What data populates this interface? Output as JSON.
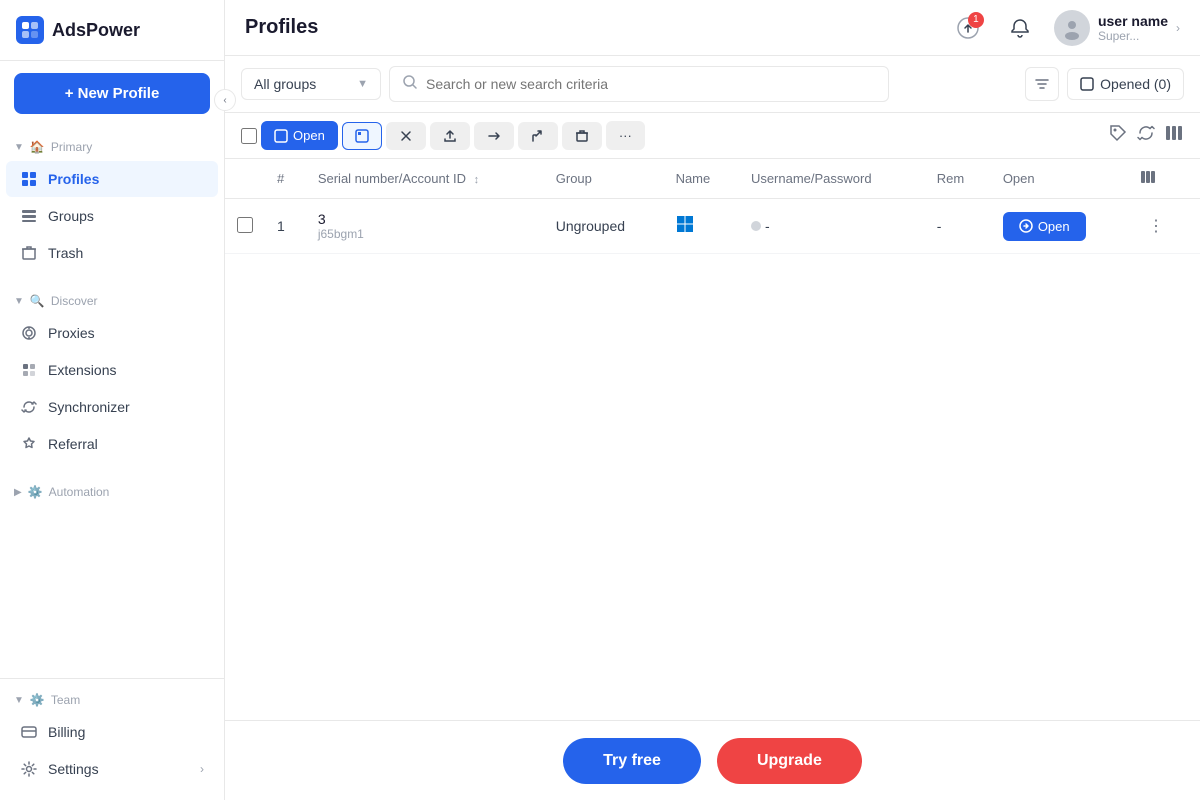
{
  "logo": {
    "icon_text": "A",
    "text": "AdsPower"
  },
  "sidebar": {
    "new_profile_label": "+ New Profile",
    "sections": {
      "primary": {
        "label": "Primary",
        "items": [
          {
            "id": "profiles",
            "label": "Profiles",
            "icon": "📁",
            "active": true
          },
          {
            "id": "groups",
            "label": "Groups",
            "icon": "🗂️",
            "active": false
          },
          {
            "id": "trash",
            "label": "Trash",
            "icon": "🗑️",
            "active": false
          }
        ]
      },
      "discover": {
        "label": "Discover",
        "items": [
          {
            "id": "proxies",
            "label": "Proxies",
            "icon": "🔀",
            "active": false
          },
          {
            "id": "extensions",
            "label": "Extensions",
            "icon": "🧩",
            "active": false
          },
          {
            "id": "synchronizer",
            "label": "Synchronizer",
            "icon": "🔄",
            "active": false
          },
          {
            "id": "referral",
            "label": "Referral",
            "icon": "⭐",
            "active": false
          }
        ]
      },
      "automation": {
        "label": "Automation",
        "items": []
      },
      "team": {
        "label": "Team",
        "items": [
          {
            "id": "billing",
            "label": "Billing",
            "icon": "💳",
            "active": false
          },
          {
            "id": "settings",
            "label": "Settings",
            "icon": "👥",
            "active": false,
            "has_chevron": true
          }
        ]
      }
    }
  },
  "header": {
    "title": "Profiles",
    "topbar_icons": {
      "upload_badge": "1",
      "notification": "🔔"
    },
    "user": {
      "name": "user name",
      "role": "Super..."
    }
  },
  "toolbar": {
    "groups_select": "All groups",
    "search_placeholder": "Search or new search criteria",
    "opened_label": "Opened (0)",
    "checkbox_label": ""
  },
  "action_buttons": [
    {
      "id": "open",
      "label": "Open",
      "primary": true,
      "icon": "▶"
    },
    {
      "id": "browser",
      "label": "",
      "icon": "⬜",
      "active_outline": true
    },
    {
      "id": "close",
      "label": "",
      "icon": "✕"
    },
    {
      "id": "export",
      "label": "",
      "icon": "⬆"
    },
    {
      "id": "move",
      "label": "",
      "icon": "➡"
    },
    {
      "id": "share",
      "label": "",
      "icon": "↗"
    },
    {
      "id": "delete",
      "label": "",
      "icon": "🗑"
    },
    {
      "id": "more",
      "label": "",
      "icon": "···"
    }
  ],
  "table": {
    "columns": [
      {
        "id": "checkbox",
        "label": ""
      },
      {
        "id": "number",
        "label": "#"
      },
      {
        "id": "serial",
        "label": "Serial number/Account ID",
        "sortable": true
      },
      {
        "id": "group",
        "label": "Group"
      },
      {
        "id": "name",
        "label": "Name"
      },
      {
        "id": "username",
        "label": "Username/Password"
      },
      {
        "id": "rem",
        "label": "Rem"
      },
      {
        "id": "open",
        "label": "Open"
      },
      {
        "id": "actions",
        "label": ""
      }
    ],
    "rows": [
      {
        "id": 1,
        "number": "1",
        "serial": "3",
        "account_id": "j65bgm1",
        "group": "Ungrouped",
        "has_windows_icon": true,
        "name": "",
        "username": "-",
        "rem": "-",
        "open_label": "Open"
      }
    ]
  },
  "bottom_banner": {
    "try_free_label": "Try free",
    "upgrade_label": "Upgrade"
  }
}
